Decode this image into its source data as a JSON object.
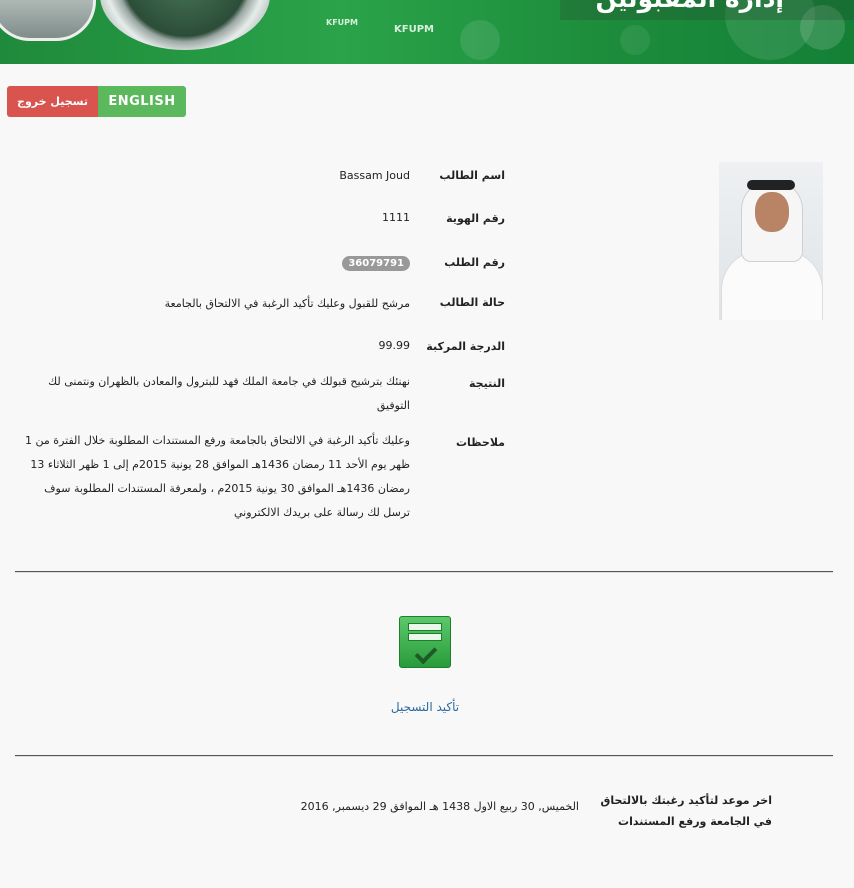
{
  "header": {
    "dept_title": "إدارة المقبولين",
    "watermark_1": "KFUPM",
    "watermark_2": "KFUPM"
  },
  "buttons": {
    "logout": "تسجيل خروج",
    "english": "ENGLISH"
  },
  "student": {
    "name_label": "اسم الطالب",
    "name": "Bassam Joud",
    "id_label": "رقم الهوية",
    "id": "1111",
    "request_label": "رقم الطلب",
    "request": "36079791",
    "status_label": "حالة الطالب",
    "status": "مرشح للقبول وعليك تأكيد الرغبة في الالتحاق بالجامعة",
    "grade_label": "الدرجة المركبة",
    "grade": "99.99",
    "result_label": "النتيجة",
    "result": "نهنئك بترشيح قبولك في جامعة الملك فهد للبترول والمعادن بالظهران ونتمنى لك التوفيق",
    "notes_label": "ملاحظات",
    "notes": "وعليك تأكيد الرغبة في الالتحاق بالجامعة ورفع المستندات المطلوبة خلال الفترة من 1 ظهر يوم الأحد 11 رمضان 1436هـ الموافق 28 يونية 2015م إلى 1 ظهر الثلاثاء 13 رمضان 1436هـ الموافق 30 يونية 2015م ، ولمعرفة المستندات المطلوبة سوف ترسل لك رسالة على بريدك الالكتروني"
  },
  "confirm": {
    "link": "تأكيد التسجيل",
    "icon": "checklist-confirm-icon"
  },
  "deadline": {
    "label": "اخر موعد لتأكيد رغبتك بالالتحاق في الجامعة ورفع المستندات",
    "value": "الخميس, 30 ربيع الاول 1438 هـ الموافق 29 ديسمبر, 2016"
  },
  "colors": {
    "header_green": "#1f8a3b",
    "logout_red": "#d9534f",
    "english_green": "#5cb85c",
    "link_blue": "#2a6aa0",
    "badge_gray": "#999999"
  }
}
